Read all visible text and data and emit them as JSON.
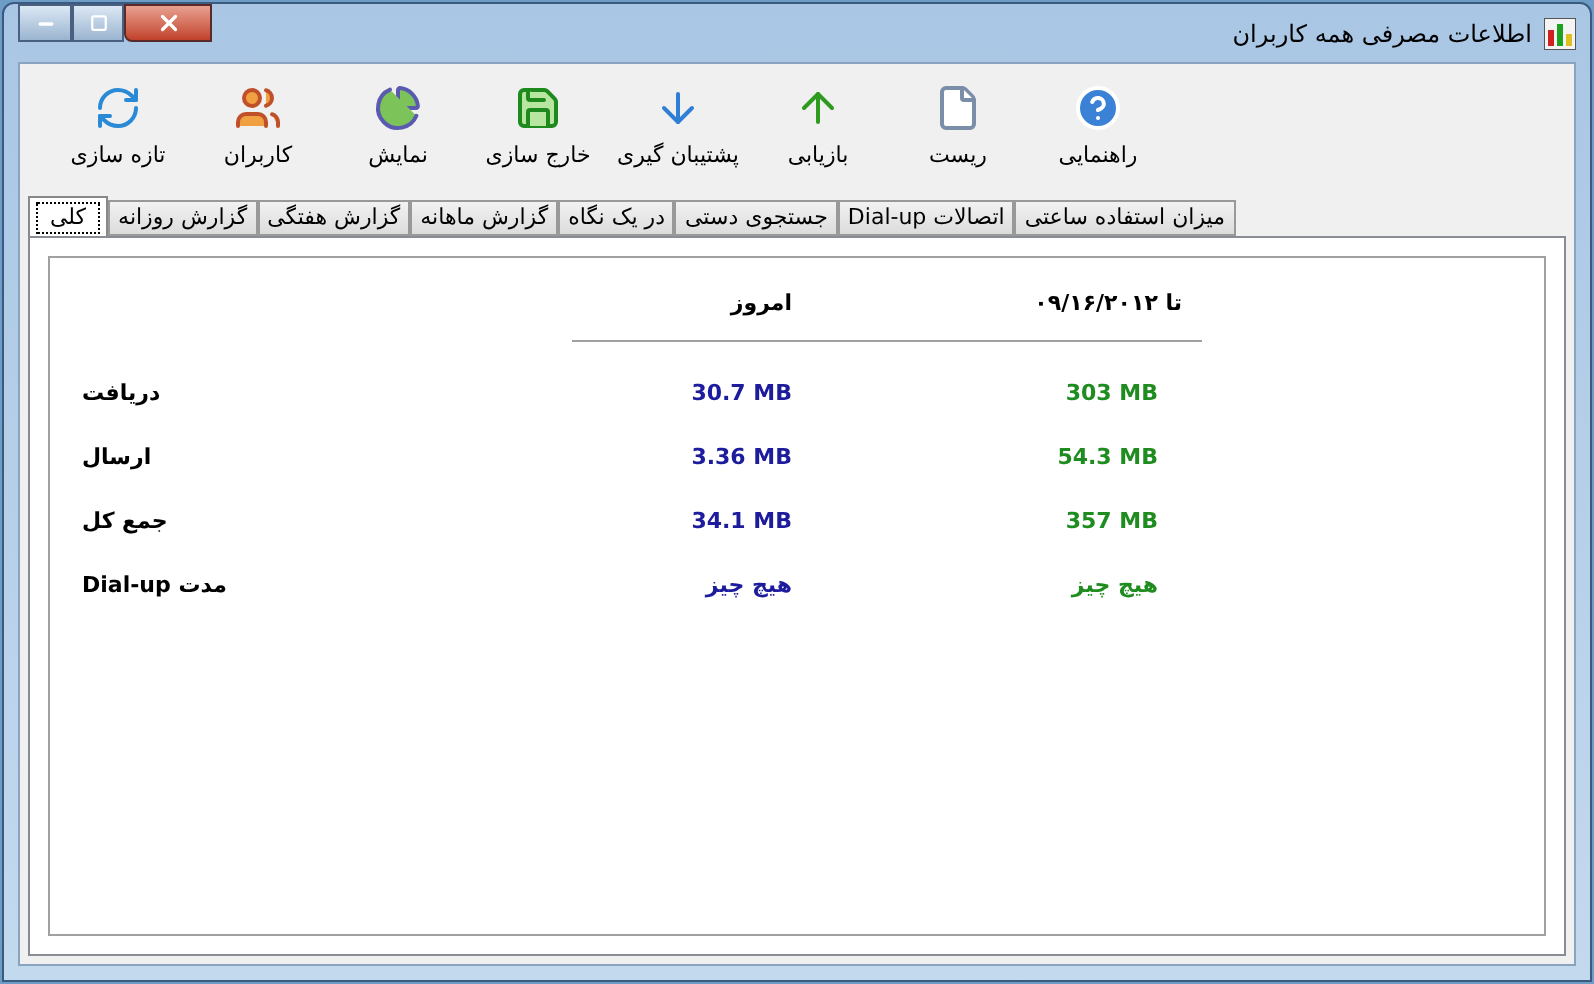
{
  "window": {
    "title": "اطلاعات مصرفی همه کاربران"
  },
  "toolbar": [
    {
      "kind": "help",
      "label": "راهنمایی"
    },
    {
      "kind": "reset",
      "label": "ریست"
    },
    {
      "kind": "restore",
      "label": "بازیابی"
    },
    {
      "kind": "backup",
      "label": "پشتیبان گیری"
    },
    {
      "kind": "export",
      "label": "خارج سازی"
    },
    {
      "kind": "show",
      "label": "نمایش"
    },
    {
      "kind": "users",
      "label": "کاربران"
    },
    {
      "kind": "refresh",
      "label": "تازه سازی"
    }
  ],
  "tabs": [
    {
      "label": "میزان استفاده ساعتی",
      "selected": false
    },
    {
      "label": "اتصالات Dial-up",
      "selected": false
    },
    {
      "label": "جستجوی دستی",
      "selected": false
    },
    {
      "label": "در یک نگاه",
      "selected": false
    },
    {
      "label": "گزارش ماهانه",
      "selected": false
    },
    {
      "label": "گزارش هفتگی",
      "selected": false
    },
    {
      "label": "گزارش روزانه",
      "selected": false
    },
    {
      "label": "کلی",
      "selected": true
    }
  ],
  "table": {
    "columns": [
      "تا ۰۹/۱۶/۲۰۱۲",
      "امروز"
    ],
    "rows": [
      {
        "total": "303 MB",
        "today": "30.7 MB",
        "label": "دریافت"
      },
      {
        "total": "54.3 MB",
        "today": "3.36 MB",
        "label": "ارسال"
      },
      {
        "total": "357 MB",
        "today": "34.1 MB",
        "label": "جمع کل"
      },
      {
        "total": "هیچ چیز",
        "today": "هیچ چیز",
        "label": "مدت Dial-up"
      }
    ]
  }
}
